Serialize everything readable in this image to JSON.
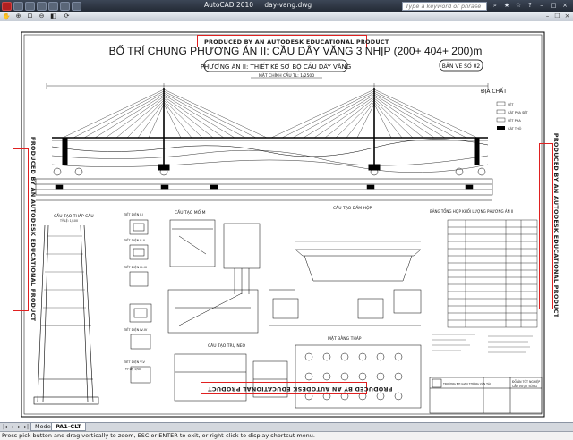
{
  "window": {
    "app_title": "AutoCAD 2010",
    "file_name": "day-vang.dwg",
    "search_placeholder": "Type a keyword or phrase"
  },
  "drawing": {
    "main_title": "BỐ TRÍ CHUNG PHƯƠNG ÁN II: CẦU DÂY VĂNG 3 NHỊP (200+ 404+ 200)m",
    "subtitle": "PHƯƠNG ÁN II: THIẾT KẾ SƠ BỘ CẦU DÂY VĂNG",
    "sheet_number": "BẢN VẼ SỐ 02",
    "elevation_label": "MẶT CHÍNH CẦU  TL: 1/2500",
    "geology_label": "ĐỊA CHẤT",
    "watermark": "PRODUCED BY AN AUTODESK EDUCATIONAL PRODUCT",
    "legend_items": [
      "SÉT",
      "CÁT PHA SÉT",
      "SÉT PHA",
      "CÁT THÔ"
    ],
    "section_titles": {
      "tower": "CẤU TẠO THÁP CẦU",
      "sections": "MẶT CẮT",
      "abutment": "CẤU TẠO MỐ M",
      "box_girder": "CẤU TẠO DẦM HỘP",
      "quantities": "BẢNG TỔNG HỢP KHỐI LƯỢNG PHƯƠNG ÁN II",
      "pier": "CẤU TẠO TRỤ NEO",
      "tower_plan": "MẶT BẰNG THÁP",
      "sec_1": "TIẾT DIỆN I-I",
      "sec_2": "TIẾT DIỆN II-II",
      "sec_3": "TIẾT DIỆN III-III",
      "sec_4": "TIẾT DIỆN IV-IV",
      "sec_5": "TIẾT DIỆN V-V",
      "scale_1_100": "TỶ LỆ: 1/100",
      "scale_1_50": "TỶ LỆ: 1/50"
    },
    "title_block": {
      "school": "TRƯỜNG ĐH GIAO THÔNG VẬN TẢI",
      "project": "ĐỒ ÁN TỐT NGHIỆP",
      "bridge": "CẦU VƯỢT SÔNG"
    }
  },
  "tabs": {
    "model": "Model",
    "layout": "PA1-CLT"
  },
  "command_line": "Press pick button and drag vertically to zoom, ESC or ENTER to exit, or right-click to display shortcut menu.",
  "colors": {
    "watermark_box": "#e02020",
    "titlebar": "#232a35"
  }
}
